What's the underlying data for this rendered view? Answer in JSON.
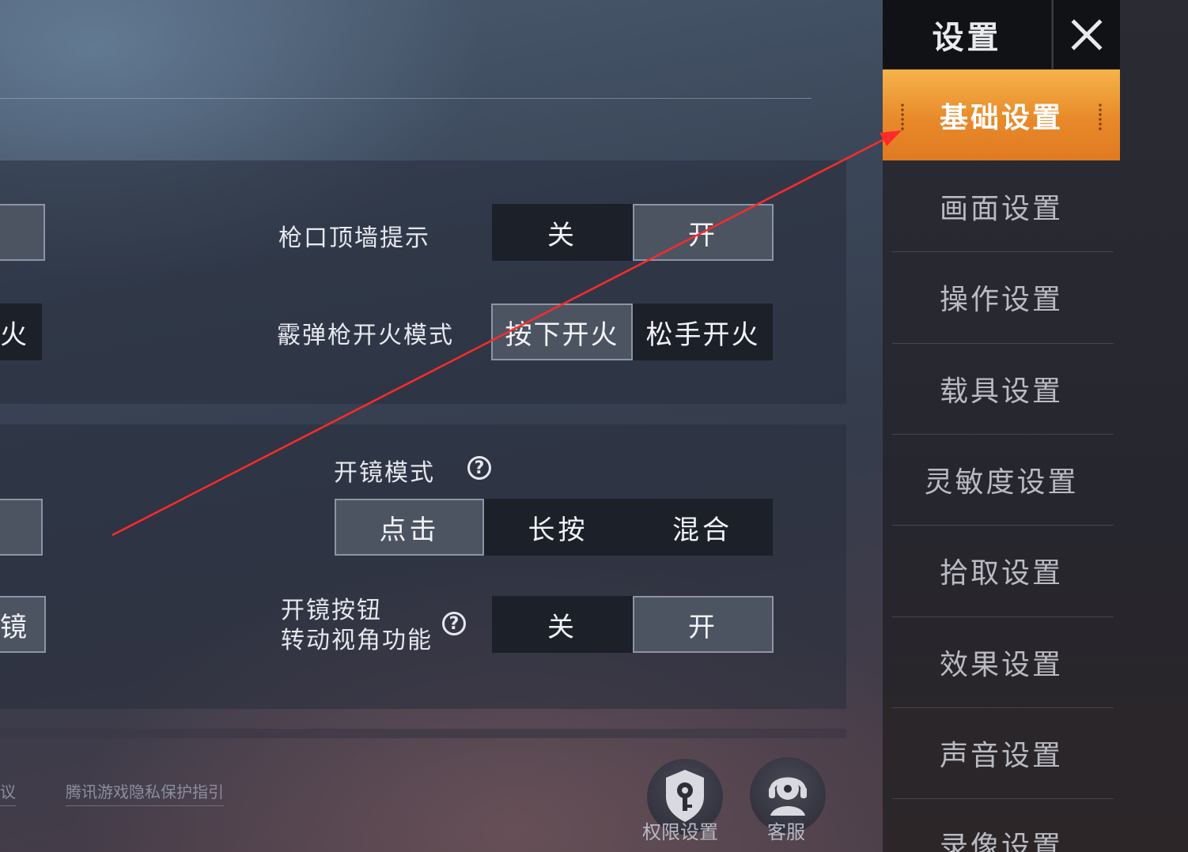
{
  "settings": {
    "muzzle_wall_hint": {
      "label": "枪口顶墙提示",
      "off": "关",
      "on": "开",
      "selected": "on"
    },
    "shotgun_fire_mode": {
      "label": "霰弹枪开火模式",
      "press": "按下开火",
      "release": "松手开火",
      "selected": "press"
    },
    "scope_mode": {
      "label": "开镜模式",
      "tap": "点击",
      "hold": "长按",
      "mixed": "混合",
      "selected": "tap"
    },
    "scope_button_rotate": {
      "label": "开镜按钮\n转动视角功能",
      "off": "关",
      "on": "开",
      "selected": "on"
    }
  },
  "left_partial": {
    "fire_text": "火",
    "scope_text": "镜"
  },
  "footer": {
    "link_partial": "议",
    "privacy_link": "腾讯游戏隐私保护指引",
    "permission_label": "权限设置",
    "service_label": "客服"
  },
  "sidebar": {
    "title": "设置",
    "items": [
      {
        "label": "基础设置",
        "active": true
      },
      {
        "label": "画面设置",
        "active": false
      },
      {
        "label": "操作设置",
        "active": false
      },
      {
        "label": "载具设置",
        "active": false
      },
      {
        "label": "灵敏度设置",
        "active": false
      },
      {
        "label": "拾取设置",
        "active": false
      },
      {
        "label": "效果设置",
        "active": false
      },
      {
        "label": "声音设置",
        "active": false
      },
      {
        "label": "录像设置",
        "active": false
      }
    ]
  },
  "colors": {
    "accent_orange": "#e8892a",
    "annotation_arrow": "#ff2a2a"
  }
}
